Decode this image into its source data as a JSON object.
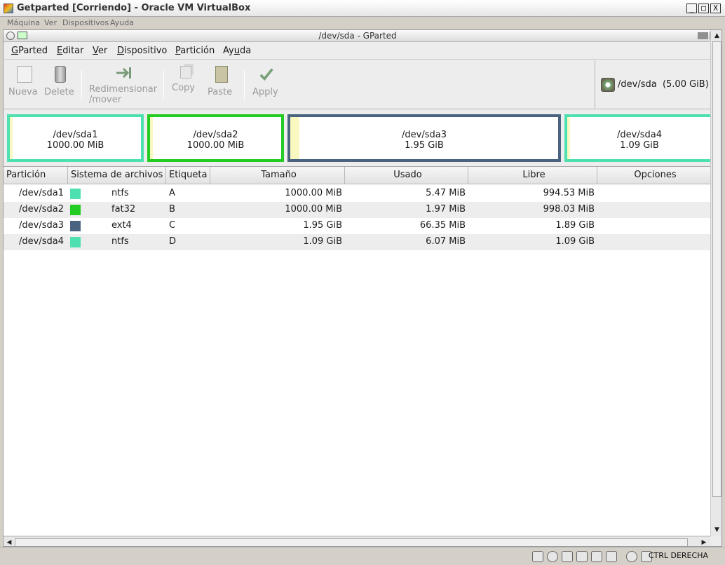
{
  "host": {
    "window_title": "Getparted [Corriendo] - Oracle VM VirtualBox",
    "window_buttons": [
      "_",
      "□",
      "X"
    ],
    "menu": [
      "Máquina",
      "Ver",
      "Dispositivos",
      "Ayuda"
    ],
    "status_text": "CTRL DERECHA",
    "status_icons": [
      "hard-disk-icon",
      "optical-disk-icon",
      "usb-icon",
      "network-icon",
      "shared-folder-icon",
      "display-icon",
      "globe-icon",
      "arrow-down-icon"
    ]
  },
  "guest": {
    "window_title": "/dev/sda - GParted",
    "menu": [
      {
        "pre": "",
        "key": "G",
        "post": "Parted"
      },
      {
        "pre": "",
        "key": "E",
        "post": "ditar"
      },
      {
        "pre": "",
        "key": "V",
        "post": "er"
      },
      {
        "pre": "",
        "key": "D",
        "post": "ispositivo"
      },
      {
        "pre": "",
        "key": "P",
        "post": "artición"
      },
      {
        "pre": "Ay",
        "key": "u",
        "post": "da"
      }
    ],
    "toolbar": {
      "new_label": "Nueva",
      "delete_label": "Delete",
      "resize_label_1": "Redimensionar",
      "resize_label_2": "/mover",
      "copy_label": "Copy",
      "paste_label": "Paste",
      "apply_label": "Apply"
    },
    "device_selector": "/dev/sda  (5.00 GiB)"
  },
  "partition_map": [
    {
      "name": "/dev/sda1",
      "size": "1000.00 MiB",
      "color": "#4ee0b0",
      "used_fraction": 0.005
    },
    {
      "name": "/dev/sda2",
      "size": "1000.00 MiB",
      "color": "#22cc22",
      "used_fraction": 0.002
    },
    {
      "name": "/dev/sda3",
      "size": "1.95 GiB",
      "color": "#4a6480",
      "used_fraction": 0.033
    },
    {
      "name": "/dev/sda4",
      "size": "1.09 GiB",
      "color": "#4ee0b0",
      "used_fraction": 0.005
    }
  ],
  "table": {
    "headers": [
      "Partición",
      "Sistema de archivos",
      "Etiqueta",
      "Tamaño",
      "Usado",
      "Libre",
      "Opciones"
    ],
    "rows": [
      {
        "partition": "/dev/sda1",
        "fs": "ntfs",
        "fs_color": "#4ee0b0",
        "label": "A",
        "size": "1000.00 MiB",
        "used": "5.47 MiB",
        "free": "994.53 MiB"
      },
      {
        "partition": "/dev/sda2",
        "fs": "fat32",
        "fs_color": "#22cc22",
        "label": "B",
        "size": "1000.00 MiB",
        "used": "1.97 MiB",
        "free": "998.03 MiB"
      },
      {
        "partition": "/dev/sda3",
        "fs": "ext4",
        "fs_color": "#4a6480",
        "label": "C",
        "size": "1.95 GiB",
        "used": "66.35 MiB",
        "free": "1.89 GiB"
      },
      {
        "partition": "/dev/sda4",
        "fs": "ntfs",
        "fs_color": "#4ee0b0",
        "label": "D",
        "size": "1.09 GiB",
        "used": "6.07 MiB",
        "free": "1.09 GiB"
      }
    ]
  }
}
